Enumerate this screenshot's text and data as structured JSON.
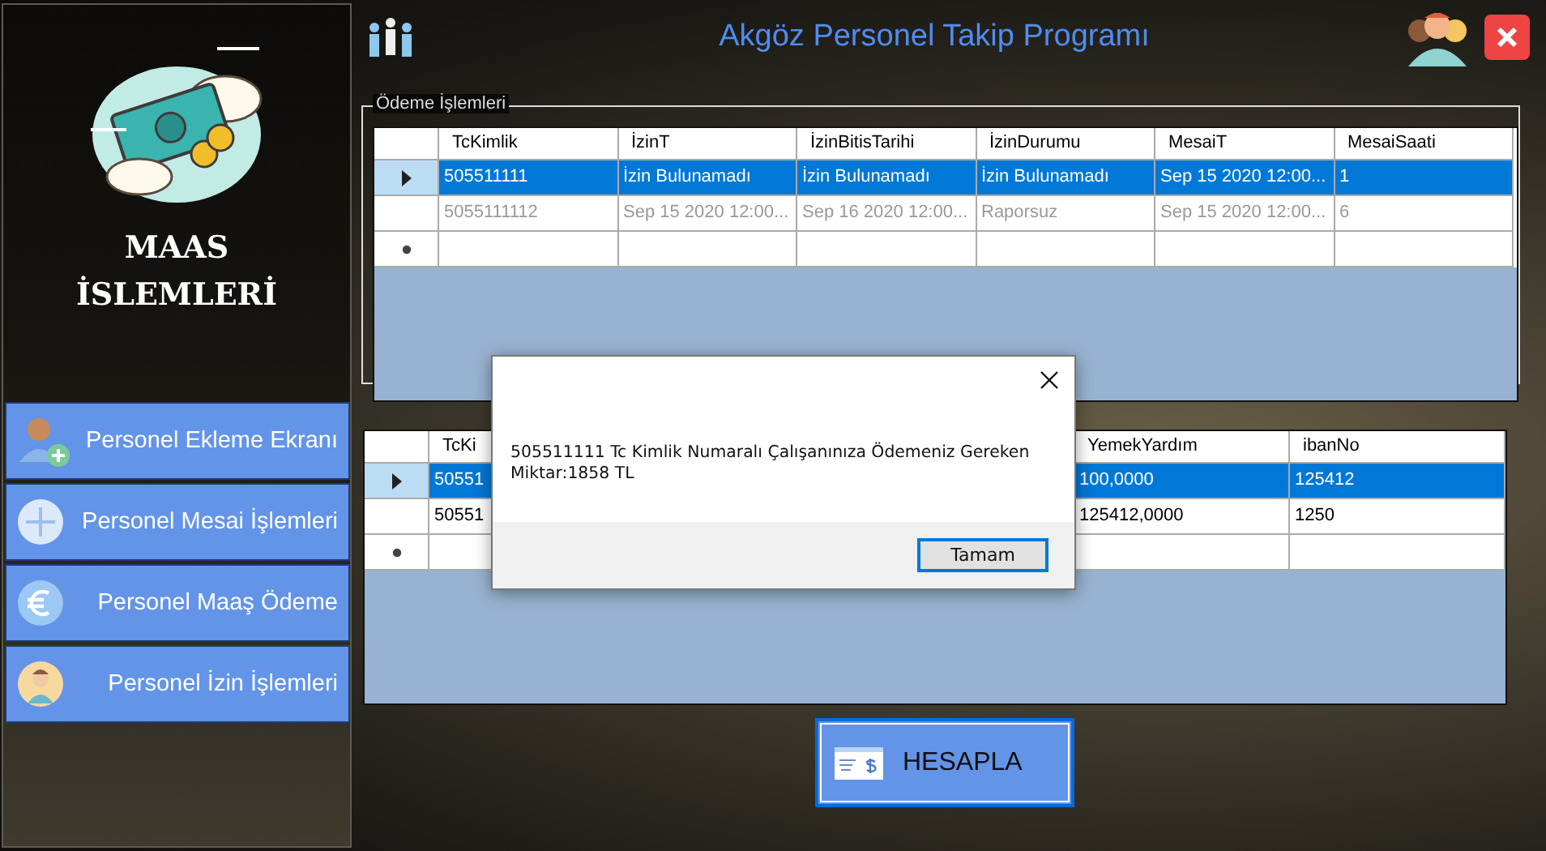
{
  "window": {
    "title": "Akgöz Personel Takip Programı"
  },
  "sidebar": {
    "heading_lines": [
      "MAAS",
      "İSLEMLERİ"
    ],
    "items": [
      {
        "label": "Personel Ekleme Ekranı"
      },
      {
        "label": "Personel Mesai İşlemleri"
      },
      {
        "label": "Personel Maaş Ödeme"
      },
      {
        "label": "Personel İzin İşlemleri"
      }
    ]
  },
  "payment_group": {
    "title": "Ödeme İşlemleri",
    "grid": {
      "columns": [
        "TcKimlik",
        "İzinT",
        "İzinBitisTarihi",
        "İzinDurumu",
        "MesaiT",
        "MesaiSaati"
      ],
      "rows": [
        {
          "selected": true,
          "greyed": false,
          "cells": [
            "505511111",
            "İzin Bulunamadı",
            "İzin Bulunamadı",
            "İzin Bulunamadı",
            "Sep 15 2020 12:00...",
            "1"
          ]
        },
        {
          "selected": false,
          "greyed": true,
          "cells": [
            "5055111112",
            "Sep 15 2020 12:00...",
            "Sep 16 2020 12:00...",
            "Raporsuz",
            "Sep 15 2020 12:00...",
            "6"
          ]
        }
      ]
    }
  },
  "second_grid": {
    "columns": [
      "TcKi",
      "YemekYardım",
      "ibanNo"
    ],
    "rows": [
      {
        "selected": true,
        "greyed": false,
        "cells": [
          "50551",
          "100,0000",
          "125412"
        ]
      },
      {
        "selected": false,
        "greyed": false,
        "cells": [
          "50551",
          "125412,0000",
          "1250"
        ]
      }
    ]
  },
  "dialog": {
    "message": "505511111 Tc Kimlik Numaralı Çalışanınıza Ödemeniz Gereken Miktar:1858 TL",
    "button": "Tamam"
  },
  "calculate_button": {
    "label": "HESAPLA"
  }
}
